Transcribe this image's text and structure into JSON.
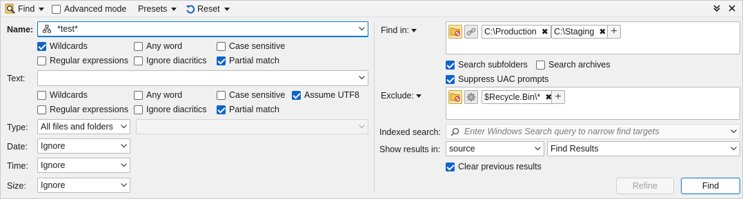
{
  "toolbar": {
    "find_label": "Find",
    "advanced_mode_label": "Advanced mode",
    "advanced_mode_checked": false,
    "presets_label": "Presets",
    "reset_label": "Reset"
  },
  "name": {
    "label": "Name:",
    "value": "*test*",
    "options": [
      {
        "label": "Wildcards",
        "checked": true
      },
      {
        "label": "Any word",
        "checked": false
      },
      {
        "label": "Case sensitive",
        "checked": false
      },
      {
        "label": "Regular expressions",
        "checked": false
      },
      {
        "label": "Ignore diacritics",
        "checked": false
      },
      {
        "label": "Partial match",
        "checked": true
      }
    ]
  },
  "text": {
    "label": "Text:",
    "value": "",
    "options": [
      {
        "label": "Wildcards",
        "checked": false
      },
      {
        "label": "Any word",
        "checked": false
      },
      {
        "label": "Case sensitive",
        "checked": false
      },
      {
        "label": "Assume UTF8",
        "checked": true
      },
      {
        "label": "Regular expressions",
        "checked": false
      },
      {
        "label": "Ignore diacritics",
        "checked": false
      },
      {
        "label": "Partial match",
        "checked": true
      }
    ]
  },
  "type": {
    "label": "Type:",
    "value": "All files and folders",
    "sub_value": ""
  },
  "date": {
    "label": "Date:",
    "value": "Ignore"
  },
  "time": {
    "label": "Time:",
    "value": "Ignore"
  },
  "size": {
    "label": "Size:",
    "value": "Ignore"
  },
  "find_in": {
    "label": "Find in:",
    "chips": [
      "C:\\Production",
      "C:\\Staging"
    ],
    "search_subfolders": {
      "label": "Search subfolders",
      "checked": true
    },
    "search_archives": {
      "label": "Search archives",
      "checked": false
    },
    "suppress_uac": {
      "label": "Suppress UAC prompts",
      "checked": true
    }
  },
  "exclude": {
    "label": "Exclude:",
    "chips": [
      "$Recycle.Bin\\*"
    ]
  },
  "indexed_search": {
    "label": "Indexed search:",
    "placeholder": "Enter Windows Search query to narrow find targets"
  },
  "show_results": {
    "label": "Show results in:",
    "source_value": "source",
    "target_value": "Find Results"
  },
  "clear_previous": {
    "label": "Clear previous results",
    "checked": true
  },
  "buttons": {
    "refine": "Refine",
    "find": "Find"
  },
  "colors": {
    "accent": "#0078d4",
    "checkbox_on": "#0e64c8",
    "panel_bg": "#f0f0f0"
  }
}
